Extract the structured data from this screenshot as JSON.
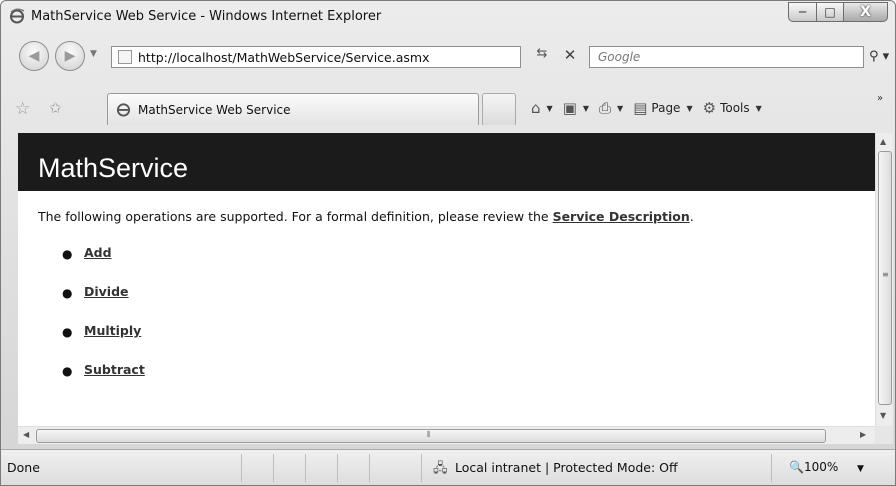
{
  "window": {
    "title": "MathService Web Service - Windows Internet Explorer",
    "minimize_glyph": "─",
    "maximize_glyph": "□",
    "close_glyph": "X"
  },
  "address_bar": {
    "url": "http://localhost/MathWebService/Service.asmx",
    "search_placeholder": "Google"
  },
  "tab": {
    "label": "MathService Web Service"
  },
  "command_bar": {
    "page_label": "Page",
    "tools_label": "Tools"
  },
  "page": {
    "heading": "MathService",
    "intro_text": "The following operations are supported. For a formal definition, please review the",
    "service_description_link": "Service Description",
    "intro_end": ".",
    "operations": [
      {
        "label": "Add"
      },
      {
        "label": "Divide"
      },
      {
        "label": "Multiply"
      },
      {
        "label": "Subtract"
      }
    ]
  },
  "status_bar": {
    "status": "Done",
    "zone": "Local intranet | Protected Mode: Off",
    "zoom": "100%"
  },
  "icons": {
    "ie_logo": "ie-logo-icon",
    "back": "back-arrow-icon",
    "forward": "forward-arrow-icon",
    "refresh": "refresh-icon",
    "stop": "stop-icon",
    "search": "search-icon",
    "favorites": "favorites-star-icon",
    "add_favorites": "add-favorites-icon",
    "home": "home-icon",
    "feeds": "feeds-icon",
    "print": "print-icon",
    "page": "page-icon",
    "tools": "gear-icon",
    "zone": "intranet-zone-icon",
    "zoom": "zoom-icon"
  },
  "colors": {
    "heading_bg": "#1b1b1b",
    "heading_text": "#ffffff",
    "link": "#333333"
  }
}
